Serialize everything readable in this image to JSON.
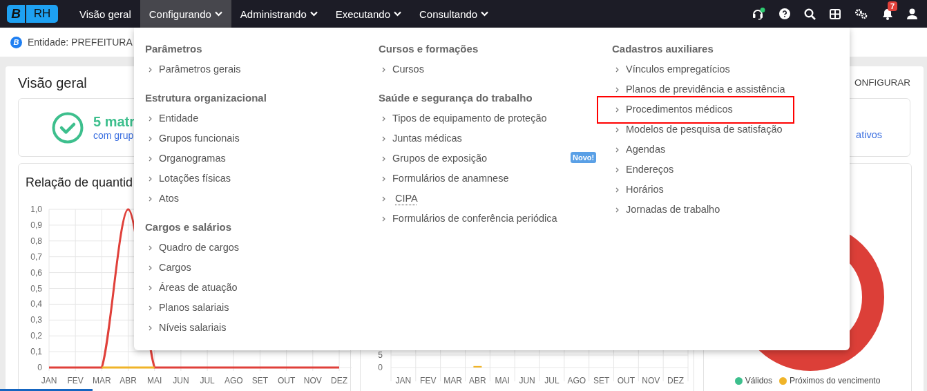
{
  "topbar": {
    "logo": {
      "letter": "B",
      "name": "RH"
    },
    "nav": [
      {
        "label": "Visão geral",
        "selected": false,
        "dropdown": false
      },
      {
        "label": "Configurando",
        "selected": true,
        "dropdown": true
      },
      {
        "label": "Administrando",
        "selected": false,
        "dropdown": true
      },
      {
        "label": "Executando",
        "selected": false,
        "dropdown": true
      },
      {
        "label": "Consultando",
        "selected": false,
        "dropdown": true
      }
    ],
    "support_online": true,
    "notifications": "7"
  },
  "entity_bar": {
    "logo_letter": "B",
    "text": "Entidade: PREFEITURA"
  },
  "overview": {
    "title": "Visão geral",
    "configure_link": "ONFIGURAR",
    "summary": {
      "count": "5 matr",
      "caption": "com grup",
      "right_text": "ativos"
    }
  },
  "charts": {
    "left": {
      "title": "Relação de quantid",
      "chart_data": {
        "type": "line",
        "categories": [
          "JAN",
          "FEV",
          "MAR",
          "ABR",
          "MAI",
          "JUN",
          "JUL",
          "AGO",
          "SET",
          "OUT",
          "NOV",
          "DEZ"
        ],
        "ylim": [
          0,
          1
        ],
        "yticks": [
          {
            "value": 0,
            "label": "0"
          },
          {
            "value": 0.1,
            "label": "0,1"
          },
          {
            "value": 0.2,
            "label": "0,2"
          },
          {
            "value": 0.3,
            "label": "0,3"
          },
          {
            "value": 0.4,
            "label": "0,4"
          },
          {
            "value": 0.5,
            "label": "0,5"
          },
          {
            "value": 0.6,
            "label": "0,6"
          },
          {
            "value": 0.7,
            "label": "0,7"
          },
          {
            "value": 0.8,
            "label": "0,8"
          },
          {
            "value": 0.9,
            "label": "0,9"
          },
          {
            "value": 1,
            "label": "1,0"
          }
        ],
        "grid": true,
        "series": [
          {
            "color": "#e0403a",
            "values": [
              0,
              0,
              0,
              1,
              0,
              0,
              0,
              0,
              0,
              0,
              0,
              0
            ]
          },
          {
            "color": "#f0b429",
            "values": [
              null,
              null,
              0,
              0,
              0,
              null,
              null,
              null,
              null,
              null,
              null,
              null
            ]
          }
        ]
      }
    },
    "middle": {
      "chart_data": {
        "type": "bar",
        "categories": [
          "JAN",
          "FEV",
          "MAR",
          "ABR",
          "MAI",
          "JUN",
          "JUL",
          "AGO",
          "SET",
          "OUT",
          "NOV",
          "DEZ"
        ],
        "ylim": [
          0,
          5
        ],
        "grid": true,
        "yticks": [
          {
            "value": 0,
            "label": "0"
          },
          {
            "value": 5,
            "label": "5"
          }
        ],
        "series": [
          {
            "color": "#f0b429",
            "values": [
              0,
              0,
              0,
              0.6,
              0,
              0,
              0,
              0,
              0,
              0,
              0,
              0
            ]
          }
        ]
      }
    },
    "right": {
      "legend": [
        {
          "label": "Válidos",
          "color": "#3dbf8d"
        },
        {
          "label": "Próximos do vencimento",
          "color": "#f0b429"
        }
      ]
    }
  },
  "mega_menu": {
    "columns": [
      [
        {
          "heading": "Parâmetros",
          "items": [
            {
              "label": "Parâmetros gerais",
              "highlighted": false,
              "underlined": false
            }
          ]
        },
        {
          "heading": "Estrutura organizacional",
          "items": [
            {
              "label": "Entidade",
              "highlighted": false,
              "underlined": false
            },
            {
              "label": "Grupos funcionais",
              "highlighted": false,
              "underlined": false
            },
            {
              "label": "Organogramas",
              "highlighted": false,
              "underlined": false
            },
            {
              "label": "Lotações físicas",
              "highlighted": false,
              "underlined": false
            },
            {
              "label": "Atos",
              "highlighted": false,
              "underlined": false
            }
          ]
        },
        {
          "heading": "Cargos e salários",
          "items": [
            {
              "label": "Quadro de cargos",
              "highlighted": false,
              "underlined": false
            },
            {
              "label": "Cargos",
              "highlighted": false,
              "underlined": false
            },
            {
              "label": "Áreas de atuação",
              "highlighted": false,
              "underlined": false
            },
            {
              "label": "Planos salariais",
              "highlighted": false,
              "underlined": false
            },
            {
              "label": "Níveis salariais",
              "highlighted": false,
              "underlined": false
            }
          ]
        }
      ],
      [
        {
          "heading": "Cursos e formações",
          "items": [
            {
              "label": "Cursos",
              "highlighted": false,
              "underlined": false
            }
          ]
        },
        {
          "heading": "Saúde e segurança do trabalho",
          "items": [
            {
              "label": "Tipos de equipamento de proteção",
              "highlighted": false,
              "underlined": false
            },
            {
              "label": "Juntas médicas",
              "highlighted": false,
              "underlined": false
            },
            {
              "label": "Grupos de exposição",
              "highlighted": false,
              "underlined": false,
              "badge": "Novo!"
            },
            {
              "label": "Formulários de anamnese",
              "highlighted": false,
              "underlined": false
            },
            {
              "label": "CIPA",
              "highlighted": false,
              "underlined": true
            },
            {
              "label": "Formulários de conferência periódica",
              "highlighted": false,
              "underlined": false
            }
          ]
        }
      ],
      [
        {
          "heading": "Cadastros auxiliares",
          "items": [
            {
              "label": "Vínculos empregatícios",
              "highlighted": false,
              "underlined": false
            },
            {
              "label": "Planos de previdência e assistência",
              "highlighted": false,
              "underlined": false
            },
            {
              "label": "Procedimentos médicos",
              "highlighted": true,
              "underlined": false
            },
            {
              "label": "Modelos de pesquisa de satisfação",
              "highlighted": false,
              "underlined": false
            },
            {
              "label": "Agendas",
              "highlighted": false,
              "underlined": false
            },
            {
              "label": "Endereços",
              "highlighted": false,
              "underlined": false
            },
            {
              "label": "Horários",
              "highlighted": false,
              "underlined": false
            },
            {
              "label": "Jornadas de trabalho",
              "highlighted": false,
              "underlined": false
            }
          ]
        }
      ]
    ]
  }
}
